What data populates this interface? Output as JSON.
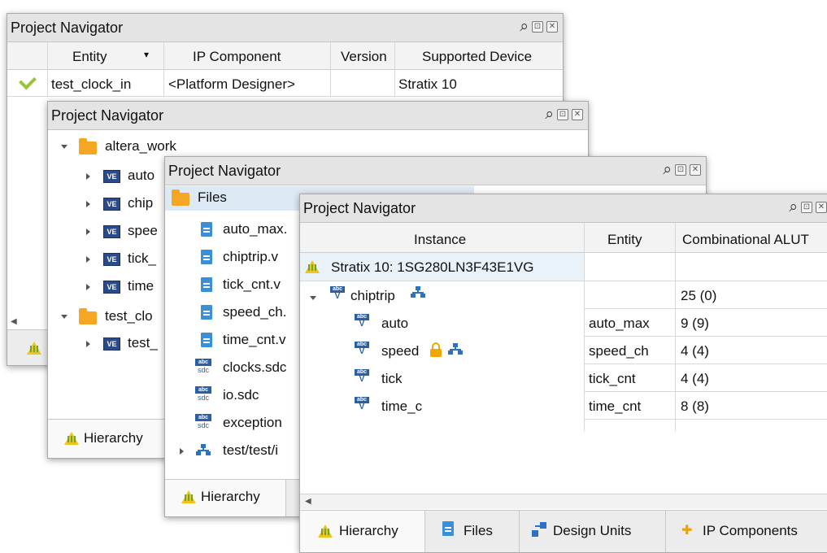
{
  "win1": {
    "title": "Project Navigator",
    "columns": [
      "Entity",
      "IP Component",
      "Version",
      "Supported Device"
    ],
    "row": {
      "entity": "test_clock_in",
      "ip": "<Platform Designer>",
      "version": "",
      "device": "Stratix 10"
    }
  },
  "win2": {
    "title": "Project Navigator",
    "folder1": "altera_work",
    "items": [
      "auto",
      "chip",
      "spee",
      "tick_",
      "time"
    ],
    "folder2": "test_clo",
    "item2": "test_",
    "tab": "Hierarchy"
  },
  "win3": {
    "title": "Project Navigator",
    "folder": "Files",
    "files": [
      "auto_max.",
      "chiptrip.v",
      "tick_cnt.v",
      "speed_ch.",
      "time_cnt.v"
    ],
    "sdc_files": [
      "clocks.sdc",
      "io.sdc",
      "exception"
    ],
    "node": "test/test/i",
    "tab": "Hierarchy"
  },
  "win4": {
    "title": "Project Navigator",
    "columns": [
      "Instance",
      "Entity",
      "Combinational ALUT"
    ],
    "device": "Stratix 10: 1SG280LN3F43E1VG",
    "rows": [
      {
        "instance": "chiptrip",
        "entity": "",
        "aluts": "25 (0)"
      },
      {
        "instance": "auto",
        "entity": "auto_max",
        "aluts": "9 (9)"
      },
      {
        "instance": "speed",
        "entity": "speed_ch",
        "aluts": "4 (4)"
      },
      {
        "instance": "tick",
        "entity": "tick_cnt",
        "aluts": "4 (4)"
      },
      {
        "instance": "time_c",
        "entity": "time_cnt",
        "aluts": "8 (8)"
      }
    ],
    "tabs": [
      "Hierarchy",
      "Files",
      "Design Units",
      "IP Components"
    ]
  },
  "icon_abbrev": {
    "ve": "VE",
    "abc": "abc",
    "v": "V",
    "sdc": "sdc",
    "sq1": "⊡",
    "sq2": "✕"
  },
  "colors": {
    "folder": "#f5a623",
    "accent_blue": "#2b5fa5",
    "warning": "#f0c419"
  }
}
